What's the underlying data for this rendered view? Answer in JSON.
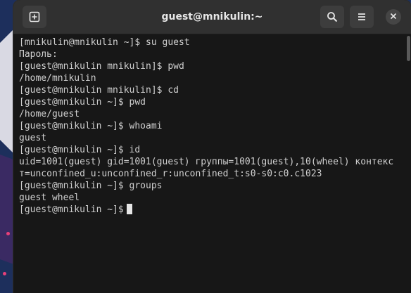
{
  "window": {
    "title": "guest@mnikulin:~"
  },
  "titlebar": {
    "new_tab_icon": "new-tab-icon",
    "search_icon": "search-icon",
    "menu_icon": "hamburger-menu-icon",
    "close_icon": "close-icon"
  },
  "terminal": {
    "lines": [
      "[mnikulin@mnikulin ~]$ su guest",
      "Пароль:",
      "[guest@mnikulin mnikulin]$ pwd",
      "/home/mnikulin",
      "[guest@mnikulin mnikulin]$ cd",
      "[guest@mnikulin ~]$ pwd",
      "/home/guest",
      "[guest@mnikulin ~]$ whoami",
      "guest",
      "[guest@mnikulin ~]$ id",
      "uid=1001(guest) gid=1001(guest) группы=1001(guest),10(wheel) контекс",
      "т=unconfined_u:unconfined_r:unconfined_t:s0-s0:c0.c1023",
      "[guest@mnikulin ~]$ groups",
      "guest wheel"
    ],
    "prompt": "[guest@mnikulin ~]$"
  },
  "colors": {
    "terminal_bg": "#171717",
    "terminal_fg": "#d0d0d0",
    "titlebar_bg": "#303030"
  }
}
